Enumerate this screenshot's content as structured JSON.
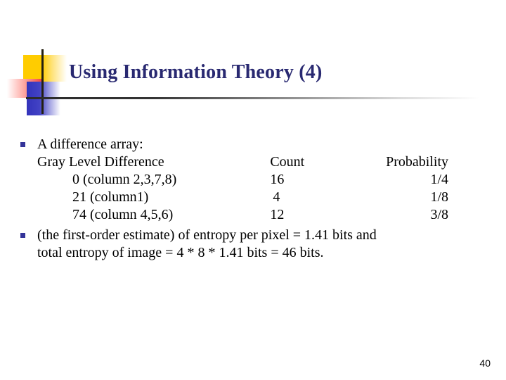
{
  "slide": {
    "title": "Using Information Theory (4)",
    "page_number": "40",
    "colors": {
      "title_blue": "#292971",
      "bullet_blue": "#333399",
      "deco_yellow": "#FFCC00",
      "deco_red": "#F4463C",
      "deco_blue": "#3333BB",
      "rule_dark": "#2B2B2B",
      "body_text": "#000000"
    }
  },
  "bullets": [
    {
      "marker": "square-bullet-icon",
      "text": "A difference array:"
    },
    {
      "marker": "square-bullet-icon",
      "line1": "(the first-order estimate) of entropy per pixel = 1.41 bits and",
      "line2": "total entropy of image = 4 * 8 * 1.41 bits = 46 bits."
    }
  ],
  "table": {
    "headers": {
      "level": "Gray Level Difference",
      "count": "Count",
      "probability": "Probability"
    },
    "rows": [
      {
        "level": "0  (column 2,3,7,8)",
        "count": "16",
        "probability": "1/4"
      },
      {
        "level": "21 (column1)",
        "count": "4",
        "probability": "1/8"
      },
      {
        "level": "74 (column 4,5,6)",
        "count": "12",
        "probability": "3/8"
      }
    ]
  }
}
